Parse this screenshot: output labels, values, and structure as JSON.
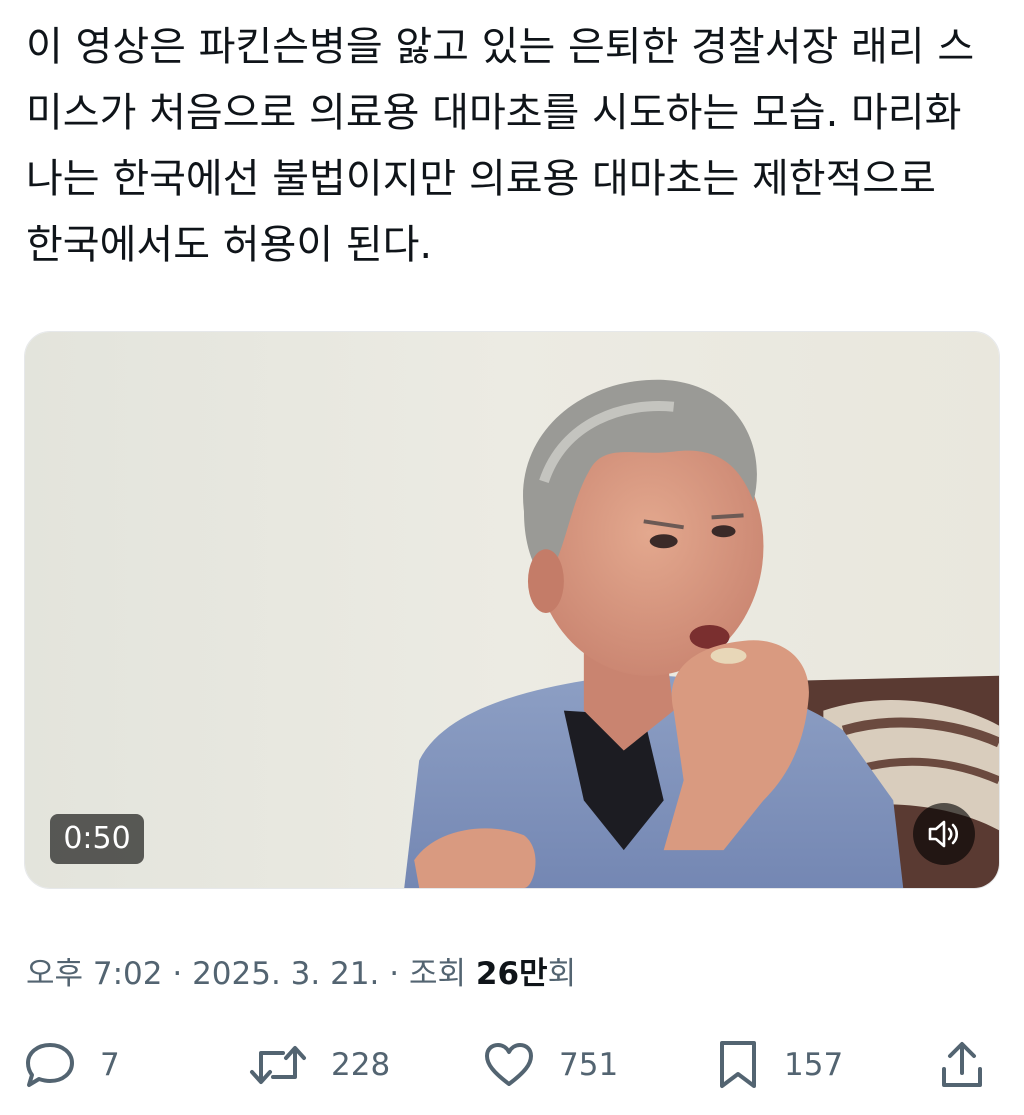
{
  "tweet": {
    "text": "이 영상은 파킨슨병을 앓고 있는 은퇴한 경찰서장 래리 스\n미스가 처음으로 의료용 대마초를 시도하는 모습. 마리화\n나는 한국에선 불법이지만 의료용 대마초는 제한적으로\n한국에서도 허용이 된다."
  },
  "media": {
    "type": "video",
    "duration": "0:50",
    "mute_icon": "speaker-muted-icon"
  },
  "meta": {
    "time": "오후 7:02",
    "separator": " · ",
    "date": "2025. 3. 21.",
    "views_label": "조회 ",
    "views_count": "26만",
    "views_suffix": "회"
  },
  "actions": {
    "reply_count": "7",
    "retweet_count": "228",
    "like_count": "751",
    "bookmark_count": "157"
  },
  "colors": {
    "text": "#0f1419",
    "secondary": "#536471",
    "background": "#ffffff"
  }
}
